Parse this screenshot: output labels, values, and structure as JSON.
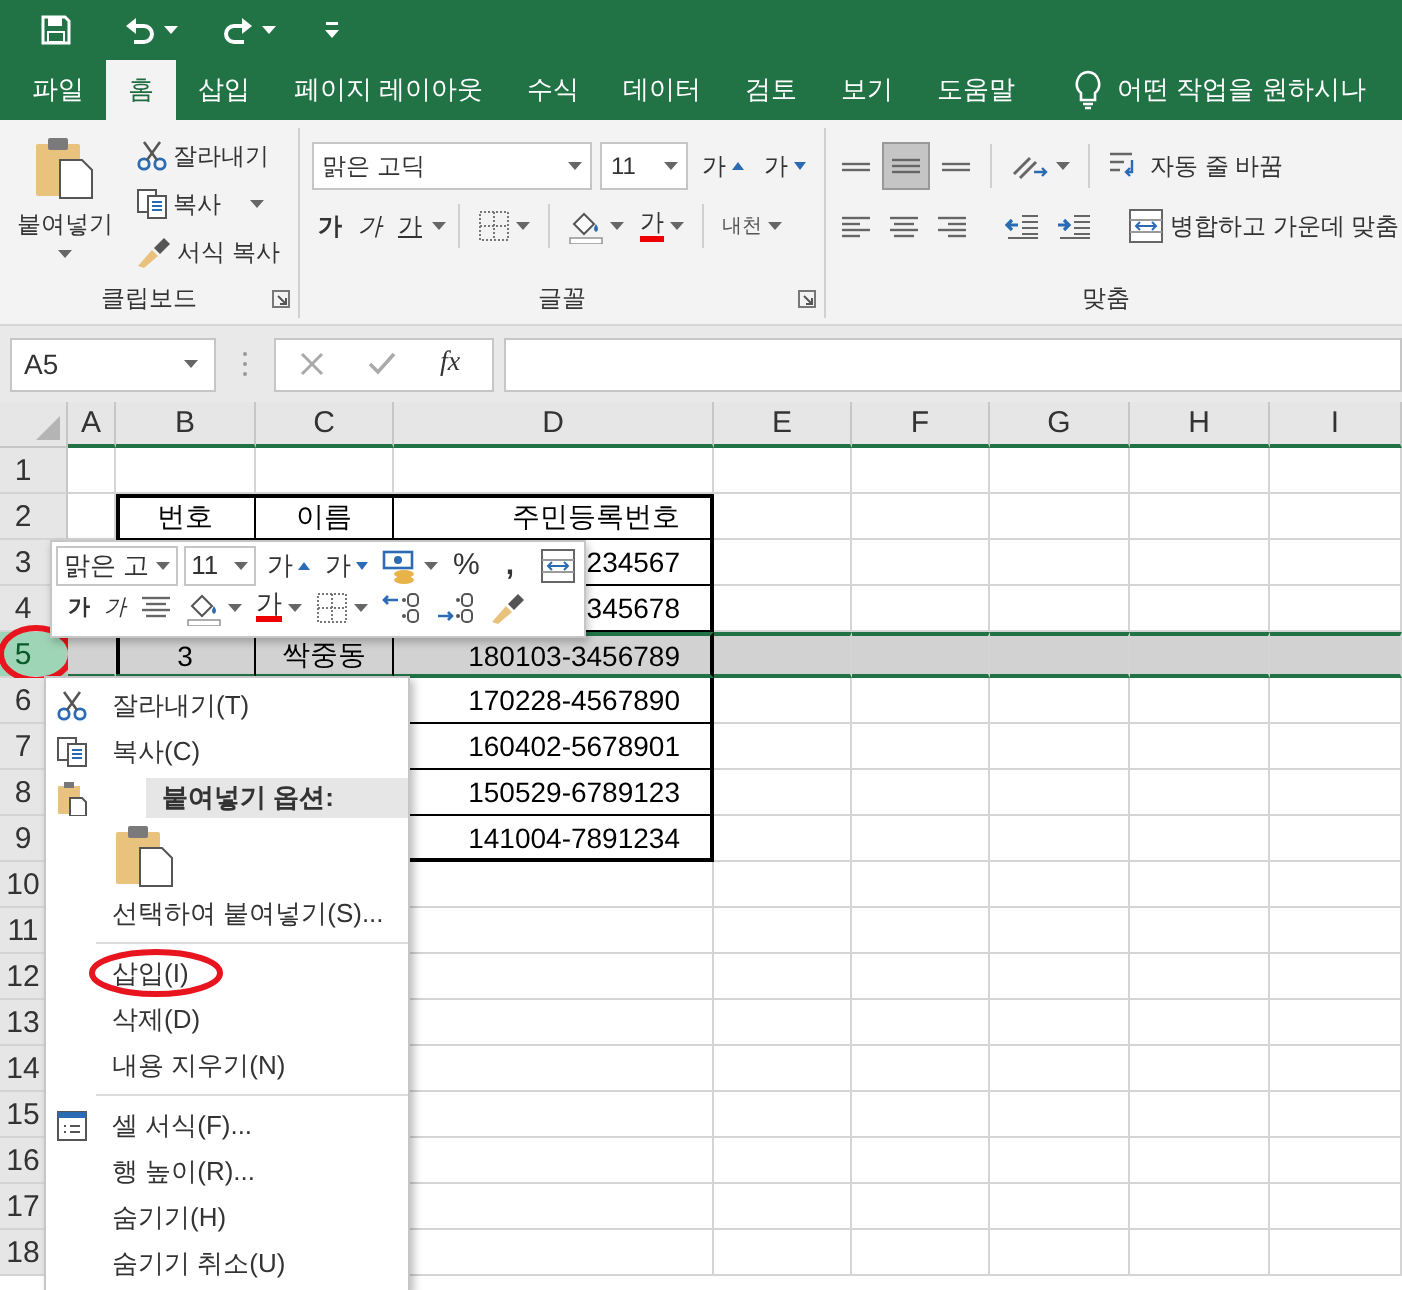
{
  "tabs": [
    {
      "label": "파일",
      "selected": false
    },
    {
      "label": "홈",
      "selected": true
    },
    {
      "label": "삽입",
      "selected": false
    },
    {
      "label": "페이지 레이아웃",
      "selected": false
    },
    {
      "label": "수식",
      "selected": false
    },
    {
      "label": "데이터",
      "selected": false
    },
    {
      "label": "검토",
      "selected": false
    },
    {
      "label": "보기",
      "selected": false
    },
    {
      "label": "도움말",
      "selected": false
    }
  ],
  "tell_me": {
    "text": "어떤 작업을 원하시나"
  },
  "ribbon": {
    "clipboard": {
      "paste": "붙여넣기",
      "cut": "잘라내기",
      "copy": "복사",
      "format_painter": "서식 복사",
      "label": "클립보드"
    },
    "font": {
      "font_name": "맑은 고딕",
      "font_size": "11",
      "grow": "가",
      "shrink": "가",
      "bold": "가",
      "italic": "가",
      "underline": "가",
      "font_color": "가",
      "phonetic": "내천",
      "label": "글꼴"
    },
    "alignment": {
      "vertical": [
        {
          "selected": false
        },
        {
          "selected": true
        },
        {
          "selected": false
        }
      ],
      "wrap_text": "자동 줄 바꿈",
      "merge_center": "병합하고 가운데 맞춤",
      "label": "맞춤"
    }
  },
  "formula_bar": {
    "name_box": "A5",
    "function_label": "fx"
  },
  "sheet": {
    "columns": [
      {
        "label": "A",
        "bordered": false
      },
      {
        "label": "B",
        "bordered": true
      },
      {
        "label": "C",
        "bordered": true
      },
      {
        "label": "D",
        "bordered": true
      },
      {
        "label": "E",
        "bordered": false
      },
      {
        "label": "F",
        "bordered": false
      },
      {
        "label": "G",
        "bordered": false
      },
      {
        "label": "H",
        "bordered": false
      },
      {
        "label": "I",
        "bordered": false
      }
    ],
    "rows": [
      {
        "header": "1",
        "selected": false,
        "annotated": false,
        "bordered": false
      },
      {
        "header": "2",
        "selected": false,
        "annotated": false,
        "bordered": true,
        "cells": {
          "B": "번호",
          "C": "이름",
          "D": "주민등록번호"
        }
      },
      {
        "header": "3",
        "selected": false,
        "annotated": false,
        "bordered": true,
        "cells": {
          "D": "234567"
        }
      },
      {
        "header": "4",
        "selected": false,
        "annotated": false,
        "bordered": true,
        "cells": {
          "D": "345678"
        }
      },
      {
        "header": "5",
        "selected": true,
        "annotated": true,
        "bordered": true,
        "cells": {
          "B": "3",
          "C": "싹중동",
          "D": "180103-3456789"
        }
      },
      {
        "header": "6",
        "selected": false,
        "annotated": false,
        "bordered": true,
        "cells": {
          "D": "170228-4567890"
        }
      },
      {
        "header": "7",
        "selected": false,
        "annotated": false,
        "bordered": true,
        "cells": {
          "D": "160402-5678901"
        }
      },
      {
        "header": "8",
        "selected": false,
        "annotated": false,
        "bordered": true,
        "cells": {
          "D": "150529-6789123"
        }
      },
      {
        "header": "9",
        "selected": false,
        "annotated": false,
        "bordered": true,
        "cells": {
          "D": "141004-7891234"
        }
      },
      {
        "header": "10",
        "selected": false,
        "annotated": false,
        "bordered": false
      },
      {
        "header": "11",
        "selected": false,
        "annotated": false,
        "bordered": false
      },
      {
        "header": "12",
        "selected": false,
        "annotated": false,
        "bordered": false
      },
      {
        "header": "13",
        "selected": false,
        "annotated": false,
        "bordered": false
      },
      {
        "header": "14",
        "selected": false,
        "annotated": false,
        "bordered": false
      },
      {
        "header": "15",
        "selected": false,
        "annotated": false,
        "bordered": false
      },
      {
        "header": "16",
        "selected": false,
        "annotated": false,
        "bordered": false
      },
      {
        "header": "17",
        "selected": false,
        "annotated": false,
        "bordered": false
      },
      {
        "header": "18",
        "selected": false,
        "annotated": false,
        "bordered": false
      }
    ]
  },
  "mini_toolbar": {
    "font_name": "맑은 고",
    "font_size": "11",
    "grow": "가",
    "shrink": "가",
    "percent": "%",
    "comma": ",",
    "bold": "가",
    "italic": "가",
    "font_color": "가"
  },
  "context_menu": {
    "items": [
      {
        "kind": "cut",
        "label": "잘라내기(T)",
        "annotated": false
      },
      {
        "kind": "copy",
        "label": "복사(C)",
        "annotated": false
      },
      {
        "kind": "paste_header",
        "label": "붙여넣기 옵션:",
        "annotated": false
      },
      {
        "kind": "paste_option"
      },
      {
        "kind": "item",
        "label": "선택하여 붙여넣기(S)...",
        "annotated": false
      },
      {
        "kind": "separator"
      },
      {
        "kind": "item",
        "label": "삽입(I)",
        "annotated": true
      },
      {
        "kind": "item",
        "label": "삭제(D)",
        "annotated": false
      },
      {
        "kind": "item",
        "label": "내용 지우기(N)",
        "annotated": false
      },
      {
        "kind": "separator"
      },
      {
        "kind": "format",
        "label": "셀 서식(F)...",
        "annotated": false
      },
      {
        "kind": "item",
        "label": "행 높이(R)...",
        "annotated": false
      },
      {
        "kind": "item",
        "label": "숨기기(H)",
        "annotated": false
      },
      {
        "kind": "item",
        "label": "숨기기 취소(U)",
        "annotated": false
      }
    ]
  }
}
